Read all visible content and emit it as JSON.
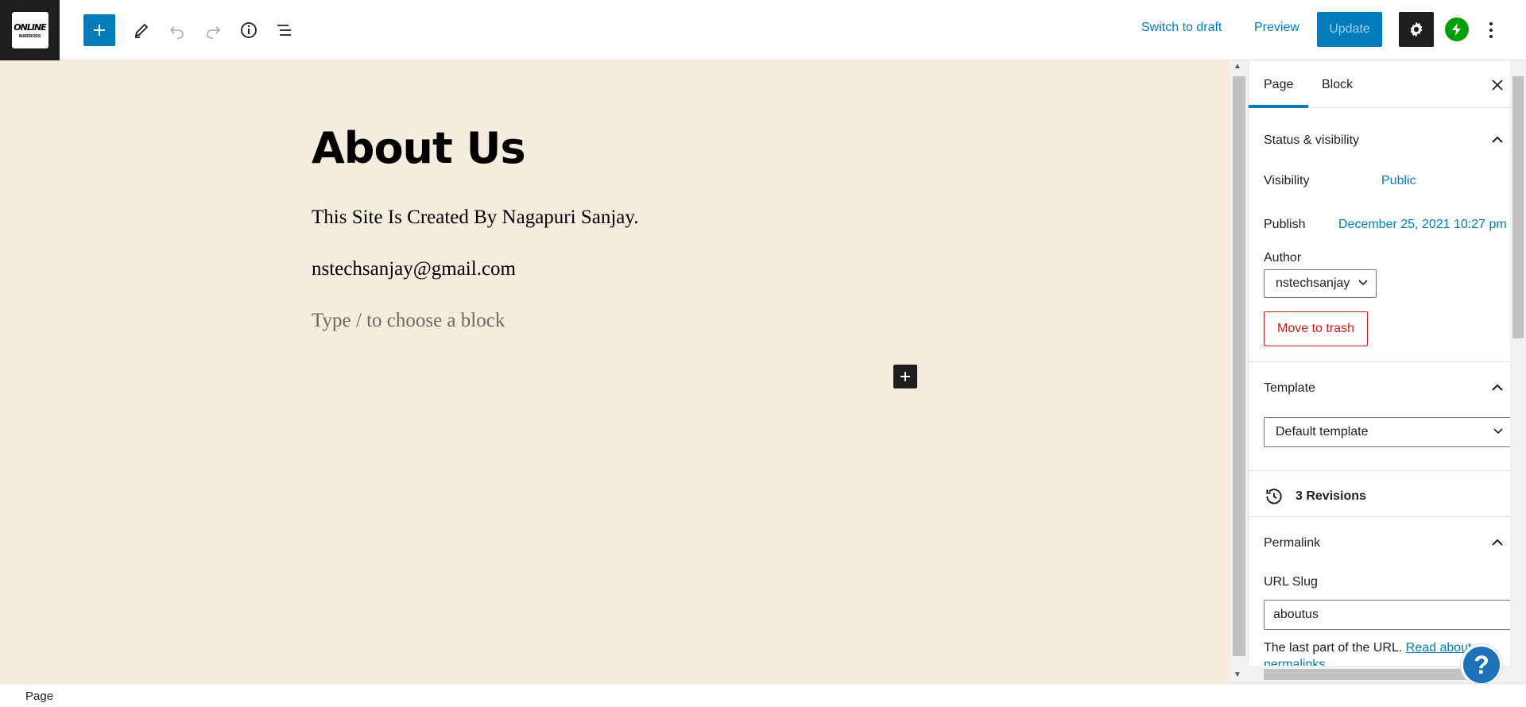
{
  "logo": {
    "line1": "ONLINE",
    "line2": "WARRIORS"
  },
  "toolbar": {
    "switch_to_draft": "Switch to draft",
    "preview": "Preview",
    "update": "Update"
  },
  "editor": {
    "title": "About Us",
    "paragraphs": [
      "This Site Is Created By Nagapuri Sanjay.",
      "nstechsanjay@gmail.com"
    ],
    "placeholder": "Type / to choose a block"
  },
  "sidebar": {
    "tabs": [
      "Page",
      "Block"
    ],
    "status": {
      "title": "Status & visibility",
      "visibility_label": "Visibility",
      "visibility_value": "Public",
      "publish_label": "Publish",
      "publish_value": "December 25, 2021 10:27 pm",
      "author_label": "Author",
      "author_value": "nstechsanjay",
      "trash": "Move to trash"
    },
    "template": {
      "title": "Template",
      "value": "Default template"
    },
    "revisions": "3 Revisions",
    "permalink": {
      "title": "Permalink",
      "slug_label": "URL Slug",
      "slug_value": "aboutus",
      "help": "The last part of the URL.",
      "help_link": "Read about",
      "help_link2": "permalinks"
    }
  },
  "help_button": "?",
  "footer": {
    "breadcrumb": "Page"
  },
  "colors": {
    "accent": "#007cba",
    "canvas_bg": "#f4eddd",
    "danger": "#cc1818",
    "jetpack": "#069e08"
  }
}
